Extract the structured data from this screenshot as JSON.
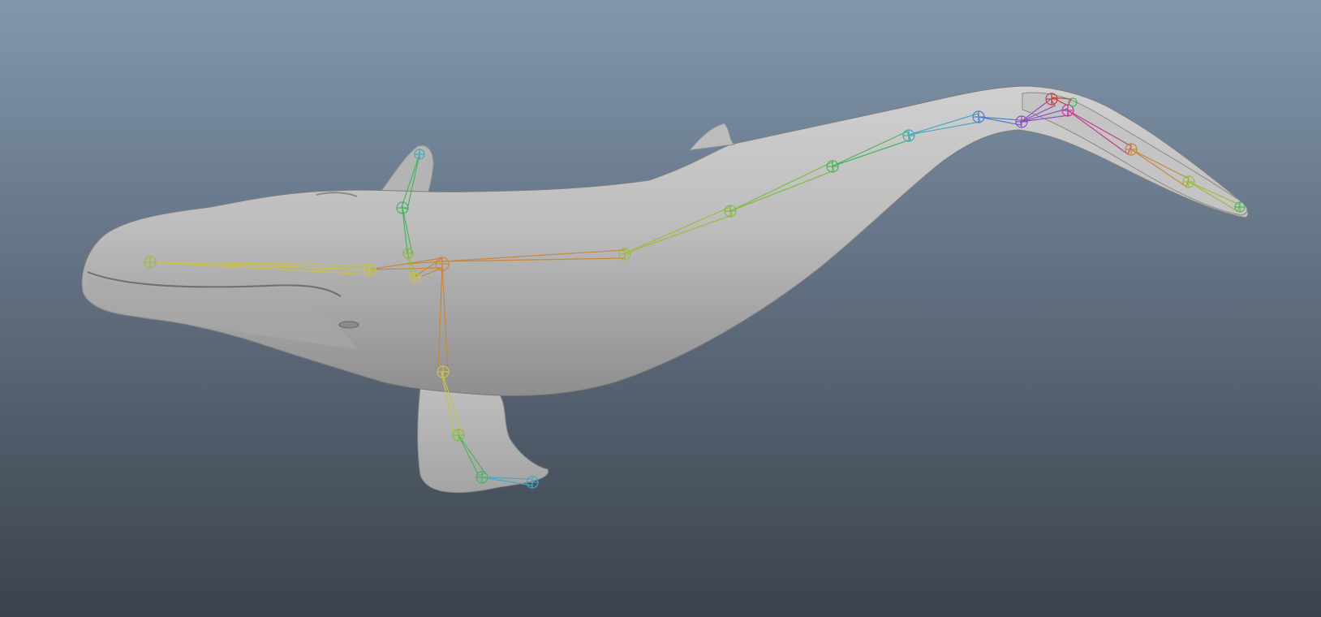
{
  "viewport": {
    "background_top": "#8196ad",
    "background_bottom": "#3b424c",
    "model": "humpback-whale",
    "model_color": "#b9b9b9",
    "skeleton_visible": true
  },
  "skeleton": {
    "colors": {
      "yellow": "#c9c24a",
      "orange": "#c8873c",
      "lime": "#9cbc3e",
      "green": "#48b560",
      "cyan": "#46a8c0",
      "blue": "#4f7fc8",
      "violet": "#8e4fc4",
      "red": "#c8453f",
      "magenta": "#c23f8f"
    }
  }
}
